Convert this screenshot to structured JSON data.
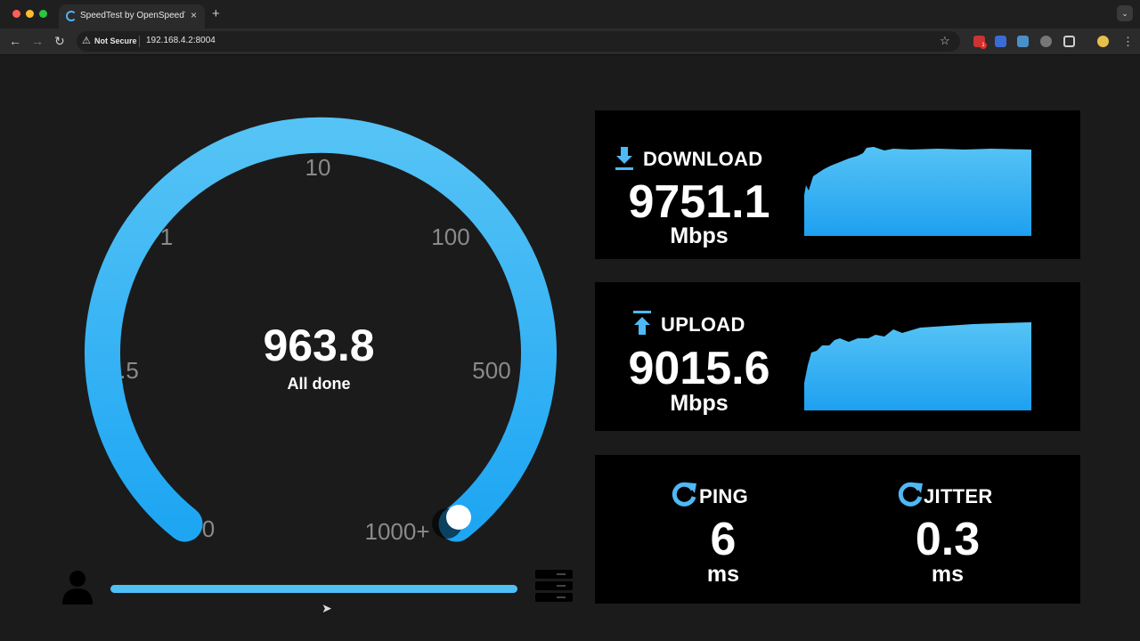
{
  "browser": {
    "tab_title": "SpeedTest by OpenSpeedTest",
    "tab_close": "×",
    "new_tab": "+",
    "security_label": "Not Secure",
    "url": "192.168.4.2:8004",
    "extension_badge": "1"
  },
  "gauge": {
    "value": "963.8",
    "status": "All done",
    "scale_labels": [
      "0",
      ".5",
      "1",
      "10",
      "100",
      "500",
      "1000+"
    ],
    "accent_color": "#4fc0f5"
  },
  "progress": {
    "fraction": 1.0
  },
  "download": {
    "label": "DOWNLOAD",
    "value": "9751.1",
    "unit": "Mbps",
    "icon": "download-arrow-icon"
  },
  "upload": {
    "label": "UPLOAD",
    "value": "9015.6",
    "unit": "Mbps",
    "icon": "upload-arrow-icon"
  },
  "ping": {
    "label": "PING",
    "value": "6",
    "unit": "ms",
    "icon": "refresh-icon"
  },
  "jitter": {
    "label": "JITTER",
    "value": "0.3",
    "unit": "ms",
    "icon": "refresh-icon"
  },
  "colors": {
    "accent": "#4fc0f5",
    "graph_top": "#55c3f5",
    "graph_bottom": "#1ea0f0",
    "card_bg": "#000000",
    "page_bg": "#1b1b1b"
  }
}
